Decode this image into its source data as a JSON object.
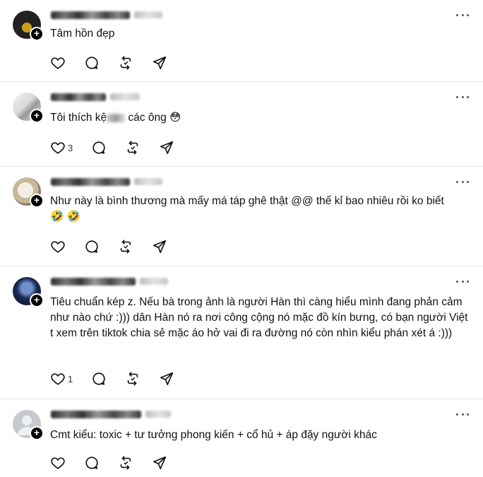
{
  "posts": [
    {
      "text": "Tâm hồn đẹp",
      "likes": "",
      "avatar": "user-photo-dark"
    },
    {
      "text_before": "Tôi thích kệ",
      "text_after": " các ông ",
      "emoji": "😳",
      "likes": "3",
      "avatar": "user-photo-light"
    },
    {
      "text": "Như này là bình thương mà mấy má táp ghê thật @@ thế kỉ bao nhiêu rồi ko biết",
      "emoji_line": "🤣 🤣",
      "likes": "",
      "avatar": "user-photo-cat"
    },
    {
      "text": "Tiêu chuẩn kép z. Nếu bà trong ảnh là người Hàn thì càng hiểu mình đang phản cảm như nào chứ :))) dân Hàn nó ra nơi công cộng nó mặc đồ kín bưng, có bạn người Việt t xem trên tiktok chia sẻ mặc áo hở vai đi ra đường nó còn nhìn kiểu phán xét á :)))",
      "likes": "1",
      "avatar": "user-photo-anime"
    },
    {
      "text": "Cmt kiểu: toxic + tư tưởng phong kiến + cổ hủ + áp đặy người khác",
      "likes": "",
      "avatar": "default-avatar"
    }
  ],
  "icons": {
    "like": "heart-icon",
    "comment": "comment-icon",
    "repost": "repost-icon",
    "share": "send-icon",
    "more": "more-icon",
    "follow": "plus-icon"
  }
}
